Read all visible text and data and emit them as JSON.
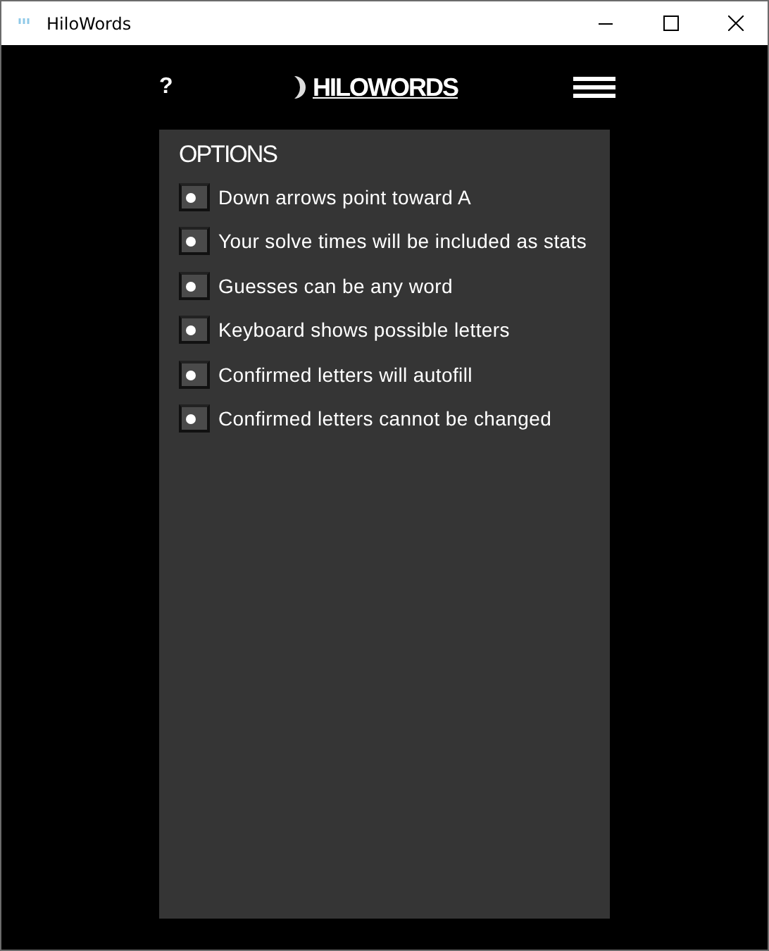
{
  "window": {
    "title": "HiloWords"
  },
  "header": {
    "help": "?",
    "logo": "HILOWORDS"
  },
  "options": {
    "title": "OPTIONS",
    "items": [
      {
        "label": "Down arrows point toward A",
        "on": false
      },
      {
        "label": "Your solve times will be included as stats",
        "on": false
      },
      {
        "label": "Guesses can be any word",
        "on": false
      },
      {
        "label": "Keyboard shows possible letters",
        "on": false
      },
      {
        "label": "Confirmed letters will autofill",
        "on": false
      },
      {
        "label": "Confirmed letters cannot be changed",
        "on": false
      }
    ]
  }
}
